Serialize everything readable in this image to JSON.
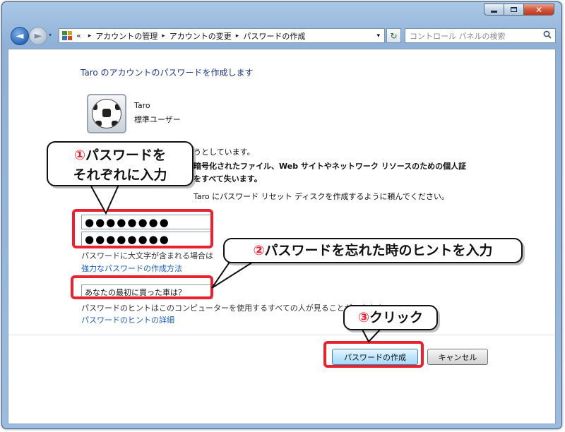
{
  "window": {
    "caption": {
      "minimize": "▁",
      "maximize": "□",
      "close": "✕"
    },
    "nav": {
      "back_glyph": "◄",
      "forward_glyph": "►",
      "dropdown_glyph": "▾"
    },
    "breadcrumbs": [
      "アカウントの管理",
      "アカウントの変更",
      "パスワードの作成"
    ],
    "breadcrumb_separator": "▸",
    "address_prefix": "«",
    "refresh_glyph": "↻",
    "search_placeholder": "コントロール パネルの検索"
  },
  "page": {
    "heading": "Taro のアカウントのパスワードを作成します",
    "user_name": "Taro",
    "user_type": "標準ユーザー",
    "info_line1": "うとしています。",
    "warning_line1": "暗号化されたファイル、Web サイトやネットワーク リソースのための個人証",
    "warning_line2": "をすべて失います。",
    "reset_disk_line": "Taro にパスワード リセット ディスクを作成するように頼んでください。",
    "password_value": "●●●●●●●●",
    "confirm_value": "●●●●●●●●",
    "case_note": "パスワードに大文字が含まれる場合は",
    "strong_pw_link": "強力なパスワードの作成方法",
    "hint_value": "あなたの最初に買った車は？",
    "hint_note": "パスワードのヒントはこのコンピューターを使用するすべての人が見ることができます。",
    "hint_details_link": "パスワードのヒントの詳細",
    "create_button": "パスワードの作成",
    "cancel_button": "キャンセル"
  },
  "annotations": {
    "c1_num": "①",
    "c1_line1": "パスワードを",
    "c1_line2": "それぞれに入力",
    "c2_num": "②",
    "c2_text": "パスワードを忘れた時のヒントを入力",
    "c3_num": "③",
    "c3_text": "クリック"
  },
  "colors": {
    "highlight": "#e8232f",
    "link": "#1f5fb8",
    "heading": "#1e3a8a"
  }
}
